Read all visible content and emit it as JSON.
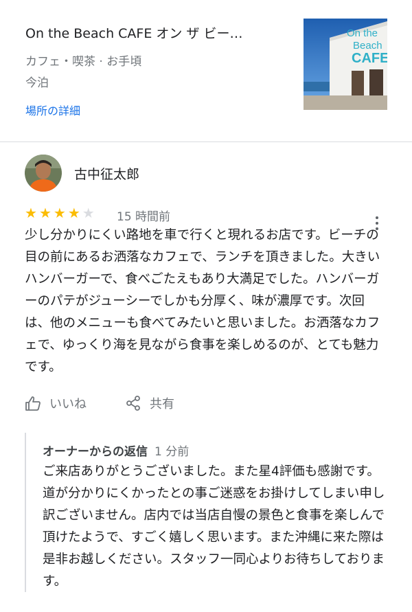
{
  "place": {
    "name": "On the Beach CAFE オン ザ ビー…",
    "category": "カフェ・喫茶 · お手頃",
    "location": "今泊",
    "details_link": "場所の詳細",
    "thumbnail_sign": [
      "On the",
      "Beach",
      "CAFE"
    ]
  },
  "review": {
    "author": "古中征太郎",
    "rating": 4,
    "rating_max": 5,
    "time": "15 時間前",
    "text": "少し分かりにくい路地を車で行くと現れるお店です。ビーチの目の前にあるお洒落なカフェで、ランチを頂きました。大きいハンバーガーで、食べごたえもあり大満足でした。ハンバーガーのパテがジューシーでしかも分厚く、味が濃厚です。次回は、他のメニューも食べてみたいと思いました。お洒落なカフェで、ゆっくり海を見ながら食事を楽しめるのが、とても魅力です。",
    "like_label": "いいね",
    "share_label": "共有"
  },
  "owner_reply": {
    "label": "オーナーからの返信",
    "time": "1 分前",
    "text": "ご来店ありがとうございました。また星4評価も感謝です。道が分かりにくかったとの事ご迷惑をお掛けしてしまい申し訳ございません。店内では当店自慢の景色と食事を楽しんで頂けたようで、すごく嬉しく思います。また沖縄に来た際は是非お越しください。スタッフ一同心よりお待ちしております。"
  },
  "colors": {
    "link": "#1a73e8",
    "star_filled": "#fbbc04",
    "star_empty": "#dadce0",
    "secondary_text": "#70757a"
  },
  "icons": {
    "more": "more-vert-icon",
    "like": "thumb-up-icon",
    "share": "share-icon"
  }
}
